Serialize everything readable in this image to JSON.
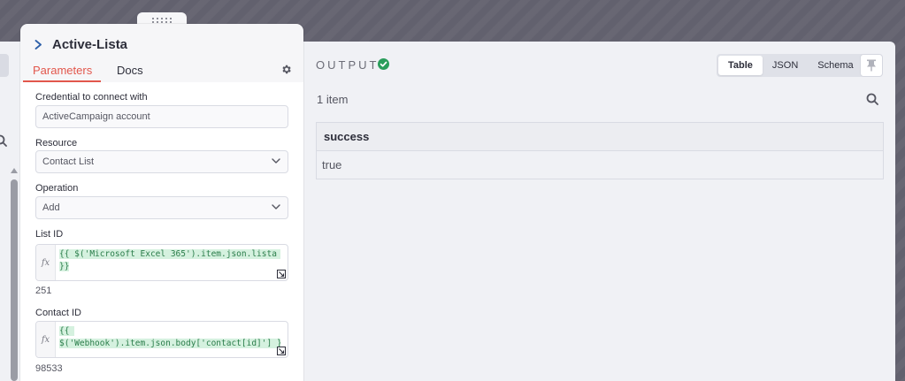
{
  "node": {
    "title": "Active-Lista",
    "tabs": {
      "parameters": "Parameters",
      "docs": "Docs"
    }
  },
  "fields": {
    "credential": {
      "label": "Credential to connect with",
      "value": "ActiveCampaign account"
    },
    "resource": {
      "label": "Resource",
      "value": "Contact List"
    },
    "operation": {
      "label": "Operation",
      "value": "Add"
    },
    "list_id": {
      "label": "List ID",
      "expression_line1": "{{ $('Microsoft Excel 365').item.json.lista ",
      "expression_line2": "}}",
      "resolved": "251"
    },
    "contact_id": {
      "label": "Contact ID",
      "expression_line1": "{{ ",
      "expression_line2": "$('Webhook').item.json.body['contact[id]'] }}",
      "resolved": "98533"
    }
  },
  "output": {
    "title": "OUTPUT",
    "views": [
      "Table",
      "JSON",
      "Schema"
    ],
    "active_view": "Table",
    "item_count": "1 item",
    "table": {
      "columns": [
        "success"
      ],
      "rows": [
        [
          "true"
        ]
      ]
    }
  },
  "colors": {
    "accent": "#e2574c",
    "success": "#2a9d5b",
    "canvas": "#646370"
  },
  "icons": {
    "node": "chevron-right-icon",
    "settings": "gear-icon",
    "status": "check-circle-icon",
    "search": "search-icon",
    "pin": "pin-icon"
  }
}
